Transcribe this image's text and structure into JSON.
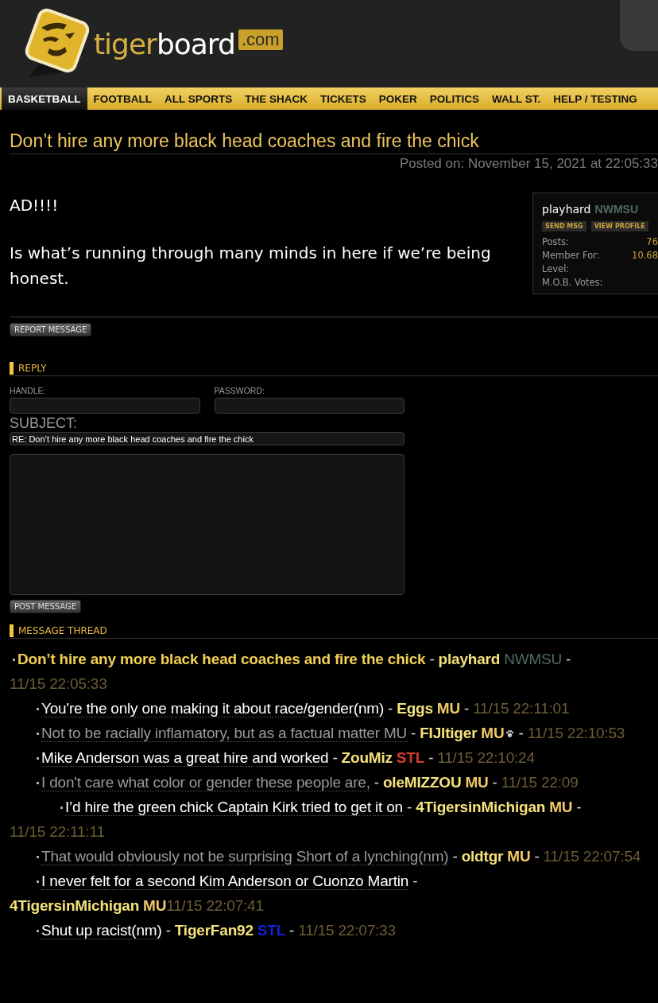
{
  "logo": {
    "word1": "tiger",
    "word2": "board",
    "suffix": ".com"
  },
  "nav": [
    {
      "label": "BASKETBALL",
      "selected": true
    },
    {
      "label": "FOOTBALL",
      "selected": false
    },
    {
      "label": "ALL SPORTS",
      "selected": false
    },
    {
      "label": "THE SHACK",
      "selected": false
    },
    {
      "label": "TICKETS",
      "selected": false
    },
    {
      "label": "POKER",
      "selected": false
    },
    {
      "label": "POLITICS",
      "selected": false
    },
    {
      "label": "WALL ST.",
      "selected": false
    },
    {
      "label": "HELP / TESTING",
      "selected": false
    }
  ],
  "post": {
    "title": "Don’t hire any more black head coaches and fire the chick",
    "posted": "Posted on: November 15, 2021 at 22:05:33",
    "body": [
      "AD!!!!",
      "Is what’s running through many minds in here if we’re being honest."
    ],
    "report_button": "REPORT MESSAGE"
  },
  "profile": {
    "username": "playhard",
    "badge": "NWMSU",
    "buttons": [
      "SEND MSG",
      "VIEW PROFILE"
    ],
    "stats": [
      {
        "label": "Posts:",
        "value": "76"
      },
      {
        "label": "Member For:",
        "value": "10.68"
      },
      {
        "label": "Level:"
      },
      {
        "label": "M.O.B. Votes:"
      }
    ]
  },
  "reply": {
    "title": "REPLY",
    "handle_label": "HANDLE:",
    "password_label": "PASSWORD:",
    "subject_label": "SUBJECT:",
    "subject_value": "RE: Don’t hire any more black head coaches and fire the chick",
    "submit_button": "POST MESSAGE"
  },
  "thread": {
    "title": "MESSAGE THREAD",
    "items": [
      {
        "subject": "Don’t hire any more black head coaches and fire the chick",
        "current": true,
        "sep1": "-",
        "author": "playhard",
        "badge": "NWMSU",
        "color": "#4e6a5c",
        "paw": false,
        "sep2": "-",
        "time": "11/15 22:05:33",
        "children": [
          {
            "subject": "You're the only one making it about race/gender(nm)",
            "current": false,
            "visited": false,
            "sep1": "-",
            "author": "Eggs",
            "badge": "MU",
            "color": "#f0c868",
            "paw": false,
            "sep2": "-",
            "time": "11/15 22:11:01"
          },
          {
            "subject": "Not to be racially inflamatory, but as a factual matter MU",
            "current": false,
            "visited": true,
            "sep1": "-",
            "author": "FIJItiger",
            "badge": "MU",
            "color": "#f0c868",
            "paw": true,
            "sep2": "-",
            "time": "11/15 22:10:53"
          },
          {
            "subject": "Mike Anderson was a great hire and worked",
            "current": false,
            "visited": false,
            "sep1": "-",
            "author": "ZouMiz",
            "badge": "STL",
            "color": "#d83a30",
            "paw": false,
            "sep2": "-",
            "time": "11/15 22:10:24"
          },
          {
            "subject": "I don't care what color or gender these people are,",
            "current": false,
            "visited": true,
            "sep1": "-",
            "author": "oleMIZZOU",
            "badge": "MU",
            "color": "#f0c868",
            "paw": false,
            "sep2": "-",
            "time": "11/15 22:09",
            "children": [
              {
                "subject": "I’d hire the green chick Captain Kirk tried to get it on",
                "current": false,
                "visited": false,
                "sep1": "-",
                "author": "4TigersinMichigan",
                "badge": "MU",
                "color": "#f0c868",
                "paw": false,
                "sep2": "-",
                "time": "11/15 22:11:11"
              }
            ]
          },
          {
            "subject": "That would obviously not be surprising Short of a lynching(nm)",
            "current": false,
            "visited": true,
            "sep1": "-",
            "author": "oldtgr",
            "badge": "MU",
            "color": "#f0c868",
            "paw": false,
            "sep2": "-",
            "time": "11/15 22:07:54"
          },
          {
            "subject": "I never felt for a second Kim Anderson or Cuonzo Martin",
            "current": false,
            "visited": false,
            "sep1": "-",
            "author": "4TigersinMichigan",
            "badge": "MU",
            "color": "#f0c868",
            "paw": false,
            "time": "11/15 22:07:41"
          },
          {
            "subject": "Shut up racist(nm)",
            "current": false,
            "visited": false,
            "sep1": "-",
            "author": "TigerFan92",
            "badge": "STL",
            "color": "#1420d8",
            "paw": false,
            "sep2": "-",
            "time": "11/15 22:07:33"
          }
        ]
      }
    ]
  }
}
